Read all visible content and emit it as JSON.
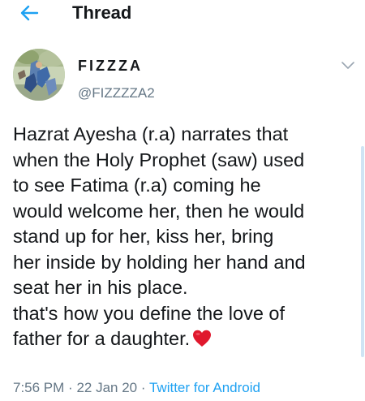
{
  "header": {
    "title": "Thread",
    "back_icon": "arrow-left-icon",
    "accent_color": "#1da1f2"
  },
  "tweet": {
    "display_name": "FIZZZA",
    "handle": "@FIZZZZA2",
    "menu_icon": "chevron-down-icon",
    "lines": [
      "Hazrat Ayesha (r.a) narrates that",
      "when the Holy Prophet (saw) used",
      "to see Fatima (r.a) coming he",
      "would welcome her, then he would",
      "stand up for her, kiss her, bring",
      "her inside by holding her hand and",
      "seat her in his place.",
      "that's how you define the love of",
      "father for a daughter."
    ],
    "emoji": "heart-icon",
    "time": "7:56 PM",
    "separator": "·",
    "date": "22 Jan 20",
    "source": "Twitter for Android"
  }
}
